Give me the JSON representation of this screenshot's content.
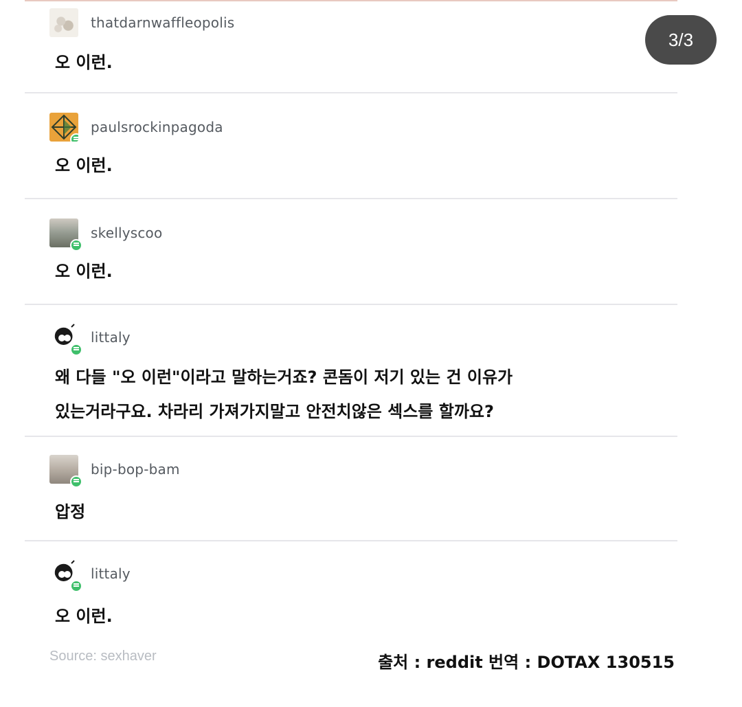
{
  "page_indicator": "3/3",
  "posts": [
    {
      "username": "thatdarnwaffleopolis",
      "text": "오 이런."
    },
    {
      "username": "paulsrockinpagoda",
      "text": "오 이런."
    },
    {
      "username": "skellyscoo",
      "text": "오 이런."
    },
    {
      "username": "littaly",
      "text": "왜 다들 \"오 이런\"이라고 말하는거죠? 콘돔이 저기 있는 건 이유가\n있는거라구요. 차라리 가져가지말고 안전치않은 섹스를 할까요?"
    },
    {
      "username": "bip-bop-bam",
      "text": "압정"
    },
    {
      "username": "littaly",
      "text": "오 이런."
    }
  ],
  "footer": {
    "source": "Source: sexhaver",
    "credit": "출처 : reddit 번역 : DOTAX 130515"
  },
  "icons": {
    "avatar_badge": "follow-badge-icon",
    "badge_color": "#3fbf6b"
  }
}
